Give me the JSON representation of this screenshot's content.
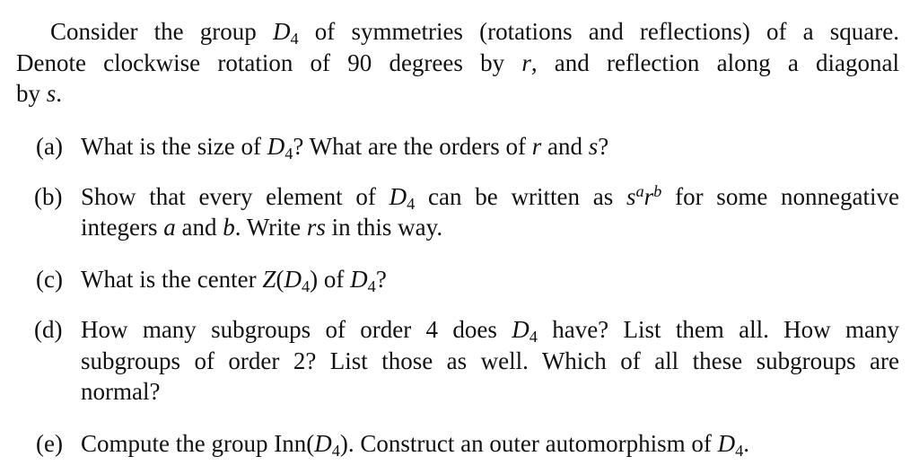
{
  "document": {
    "intro": {
      "lines": [
        [
          {
            "t": "Consider the group "
          },
          {
            "m": "D",
            "sub": "4"
          },
          {
            "t": " of symmetries (rotations and reflections) of a square."
          }
        ],
        [
          {
            "t": "Denote clockwise rotation of 90 degrees by "
          },
          {
            "m": "r"
          },
          {
            "t": ", and reflection along a diagonal"
          }
        ],
        [
          {
            "t": "by "
          },
          {
            "m": "s"
          },
          {
            "t": "."
          }
        ]
      ]
    },
    "questions": [
      {
        "label": "(a)",
        "lines": [
          [
            {
              "t": "What is the size of "
            },
            {
              "m": "D",
              "sub": "4"
            },
            {
              "t": "? What are the orders of "
            },
            {
              "m": "r"
            },
            {
              "t": " and "
            },
            {
              "m": "s"
            },
            {
              "t": "?"
            }
          ]
        ]
      },
      {
        "label": "(b)",
        "lines": [
          [
            {
              "t": "Show that every element of "
            },
            {
              "m": "D",
              "sub": "4"
            },
            {
              "t": " can be written as "
            },
            {
              "m": "s",
              "sup": "a"
            },
            {
              "m": "r",
              "sup": "b"
            },
            {
              "t": " for some nonnegative"
            }
          ],
          [
            {
              "t": "integers "
            },
            {
              "m": "a"
            },
            {
              "t": " and "
            },
            {
              "m": "b"
            },
            {
              "t": ". Write "
            },
            {
              "m": "rs"
            },
            {
              "t": " in this way."
            }
          ]
        ]
      },
      {
        "label": "(c)",
        "lines": [
          [
            {
              "t": "What is the center "
            },
            {
              "m": "Z"
            },
            {
              "t": "("
            },
            {
              "m": "D",
              "sub": "4"
            },
            {
              "t": ") of "
            },
            {
              "m": "D",
              "sub": "4"
            },
            {
              "t": "?"
            }
          ]
        ]
      },
      {
        "label": "(d)",
        "lines": [
          [
            {
              "t": "How many subgroups of order 4 does "
            },
            {
              "m": "D",
              "sub": "4"
            },
            {
              "t": " have? List them all. How many"
            }
          ],
          [
            {
              "t": "subgroups of order 2? List those as well. Which of all these subgroups are"
            }
          ],
          [
            {
              "t": "normal?"
            }
          ]
        ]
      },
      {
        "label": "(e)",
        "lines": [
          [
            {
              "t": "Compute the group Inn("
            },
            {
              "m": "D",
              "sub": "4"
            },
            {
              "t": "). Construct an outer automorphism of "
            },
            {
              "m": "D",
              "sub": "4"
            },
            {
              "t": "."
            }
          ]
        ]
      }
    ]
  }
}
